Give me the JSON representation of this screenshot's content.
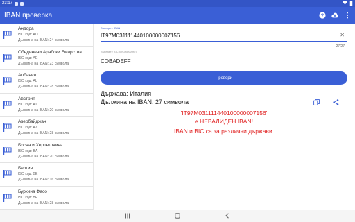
{
  "status_bar": {
    "time": "23:17"
  },
  "app_bar": {
    "title": "IBAN проверка",
    "icons": [
      "help-icon",
      "cloud-download-icon",
      "more-vert-icon"
    ]
  },
  "countries": [
    {
      "name": "Андора",
      "iso": "ISO код: AD",
      "length": "Дължина на IBAN: 24 символа"
    },
    {
      "name": "Обединени Арабски Емирства",
      "iso": "ISO код: AE",
      "length": "Дължина на IBAN: 23 символа"
    },
    {
      "name": "Албания",
      "iso": "ISO код: AL",
      "length": "Дължина на IBAN: 28 символа"
    },
    {
      "name": "Австрия",
      "iso": "ISO код: AT",
      "length": "Дължина на IBAN: 20 символа"
    },
    {
      "name": "Азербайджан",
      "iso": "ISO код: AZ",
      "length": "Дължина на IBAN: 28 символа"
    },
    {
      "name": "Босна и Херцеговина",
      "iso": "ISO код: BA",
      "length": "Дължина на IBAN: 20 символа"
    },
    {
      "name": "Белгия",
      "iso": "ISO код: BE",
      "length": "Дължина на IBAN: 16 символа"
    },
    {
      "name": "Буркина Фасо",
      "iso": "ISO код: BF",
      "length": "Дължина на IBAN: 28 символа"
    }
  ],
  "form": {
    "iban_label": "Въведете IBAN",
    "iban_value": "IT97M031111440100000007156",
    "iban_counter": "27/27",
    "bic_label": "Въведете BIC (опционално)",
    "bic_value": "COBADEFF",
    "check_button": "Провери"
  },
  "result": {
    "country": "Държава: Италия",
    "length": "Дължина на IBAN: 27 символа",
    "error_iban": "'IT97M031111440100000007156'",
    "error_invalid": "е НЕВАЛИДЕН IBAN!",
    "error_bic": "IBAN и BIC са за различни държави."
  },
  "colors": {
    "primary": "#3a5fd6",
    "error": "#e02020"
  }
}
